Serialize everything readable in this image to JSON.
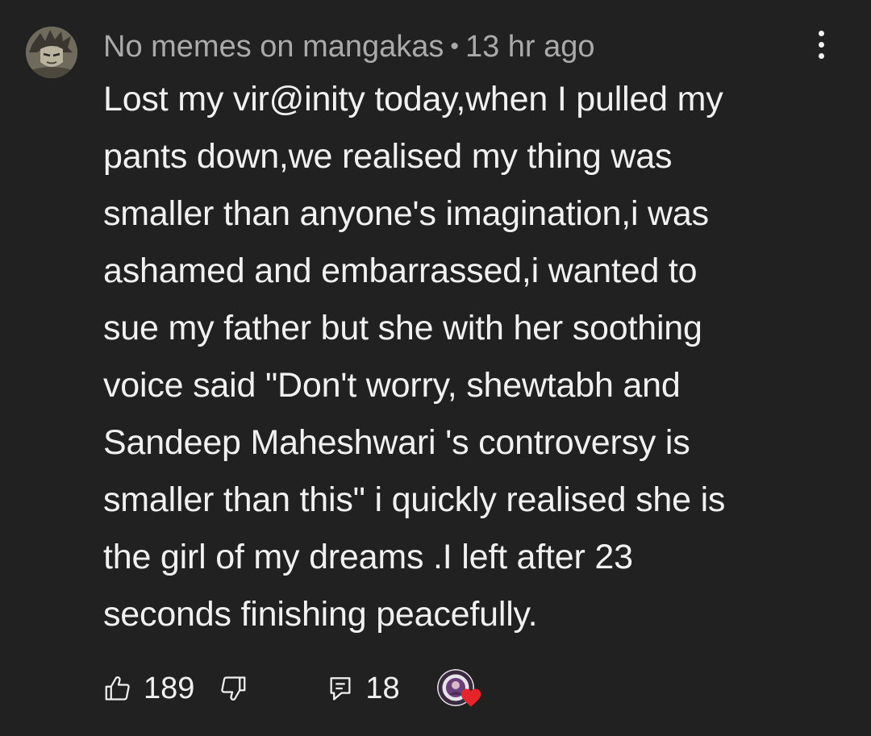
{
  "comment": {
    "author": "No memes on mangakas",
    "separator": "•",
    "timestamp": "13 hr ago",
    "text": "Lost my vir@inity today,when I pulled my\npants down,we realised my thing was\nsmaller than anyone's imagination,i was\nashamed and embarrassed,i wanted to\nsue my father but she with her soothing\nvoice said \"Don't worry, shewtabh and\nSandeep Maheshwari 's controversy is\nsmaller than this\" i quickly realised she is\nthe girl of my dreams .I left after 23\nseconds finishing peacefully.",
    "avatar_icon": "user-avatar"
  },
  "actions": {
    "like_icon": "thumbs-up-icon",
    "like_count": "189",
    "dislike_icon": "thumbs-down-icon",
    "reply_icon": "reply-comment-icon",
    "reply_count": "18",
    "creator_heart_icon": "creator-heart-icon"
  },
  "menu": {
    "icon": "more-vertical-icon"
  },
  "colors": {
    "background": "#212121",
    "primary_text": "#f1f1f1",
    "secondary_text": "#aaaaaa",
    "heart": "#e5242b"
  }
}
